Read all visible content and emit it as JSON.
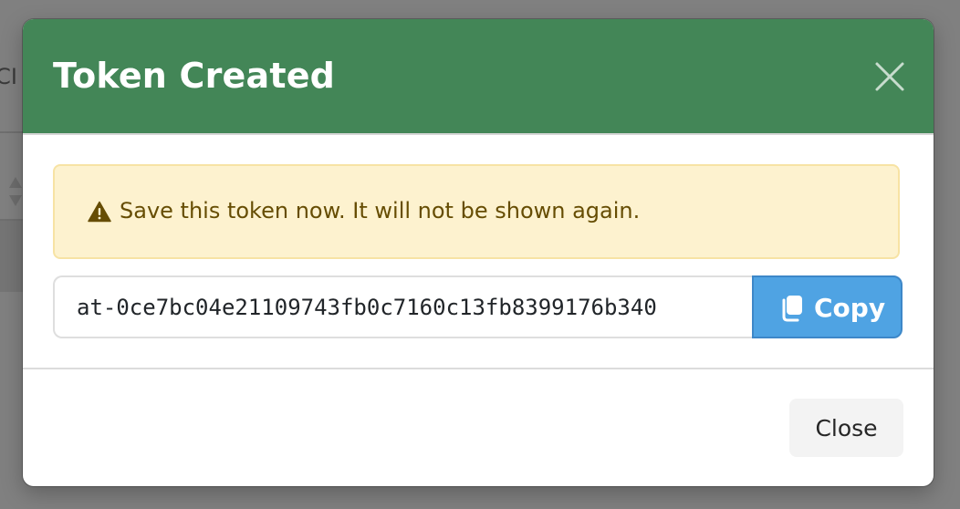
{
  "background": {
    "partial_text": "ICI"
  },
  "dialog": {
    "title": "Token Created",
    "header_color": "#438657",
    "close_icon": "close-icon",
    "alert": {
      "icon": "warning-triangle-icon",
      "text": "Save this token now. It will not be shown again.",
      "background_color": "#fdf2cf",
      "text_color": "#664d03"
    },
    "token": {
      "value": "at-0ce7bc04e21109743fb0c7160c13fb8399176b340"
    },
    "copy_button": {
      "icon": "copy-icon",
      "label": "Copy",
      "color": "#4fa3e3"
    },
    "close_button": {
      "label": "Close"
    }
  }
}
